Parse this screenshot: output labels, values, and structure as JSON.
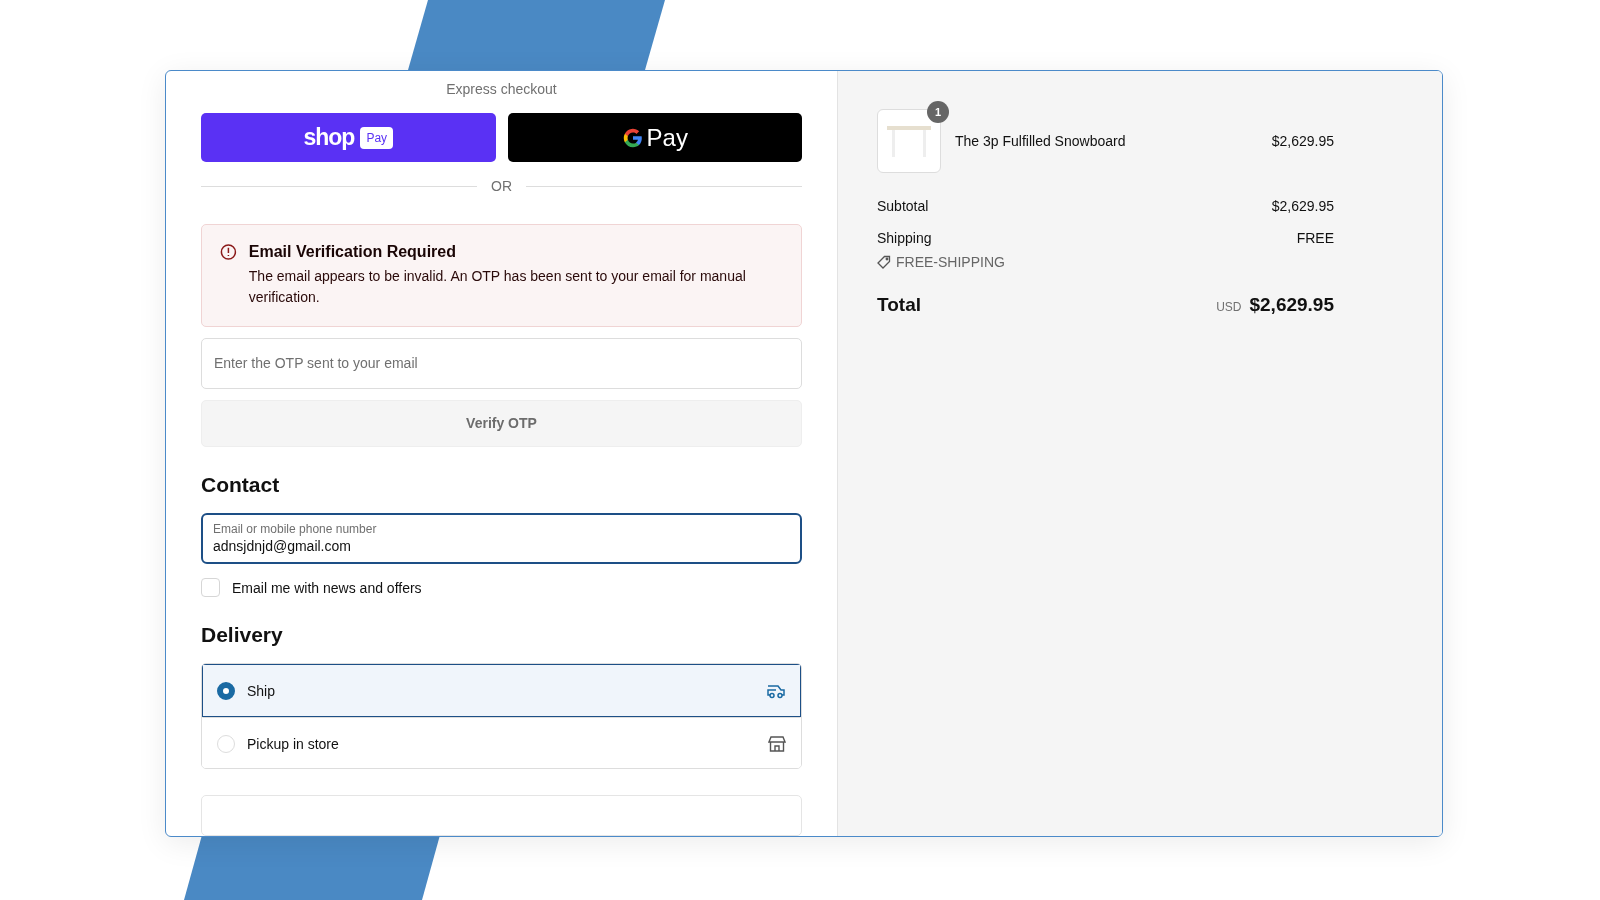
{
  "express_checkout": {
    "title": "Express checkout",
    "buttons": [
      {
        "kind": "shop_pay",
        "brand": "shop",
        "badge": "Pay"
      },
      {
        "kind": "google_pay",
        "label": "Pay"
      }
    ],
    "divider": "OR"
  },
  "alert": {
    "title": "Email Verification Required",
    "message": "The email appears to be invalid. An OTP has been sent to your email for manual verification."
  },
  "otp": {
    "placeholder": "Enter the OTP sent to your email",
    "button": "Verify OTP"
  },
  "contact": {
    "heading": "Contact",
    "field": {
      "label": "Email or mobile phone number",
      "value": "adnsjdnjd@gmail.com"
    },
    "newsletter": {
      "label": "Email me with news and offers",
      "checked": false
    }
  },
  "delivery": {
    "heading": "Delivery",
    "options": [
      {
        "kind": "ship",
        "label": "Ship",
        "selected": true
      },
      {
        "kind": "pickup",
        "label": "Pickup in store",
        "selected": false
      }
    ]
  },
  "summary": {
    "items": [
      {
        "quantity": "1",
        "name": "The 3p Fulfilled Snowboard",
        "price": "$2,629.95"
      }
    ],
    "subtotal": {
      "label": "Subtotal",
      "value": "$2,629.95"
    },
    "shipping": {
      "label": "Shipping",
      "value": "FREE",
      "discount": "FREE-SHIPPING"
    },
    "total": {
      "label": "Total",
      "currency": "USD",
      "value": "$2,629.95"
    }
  }
}
